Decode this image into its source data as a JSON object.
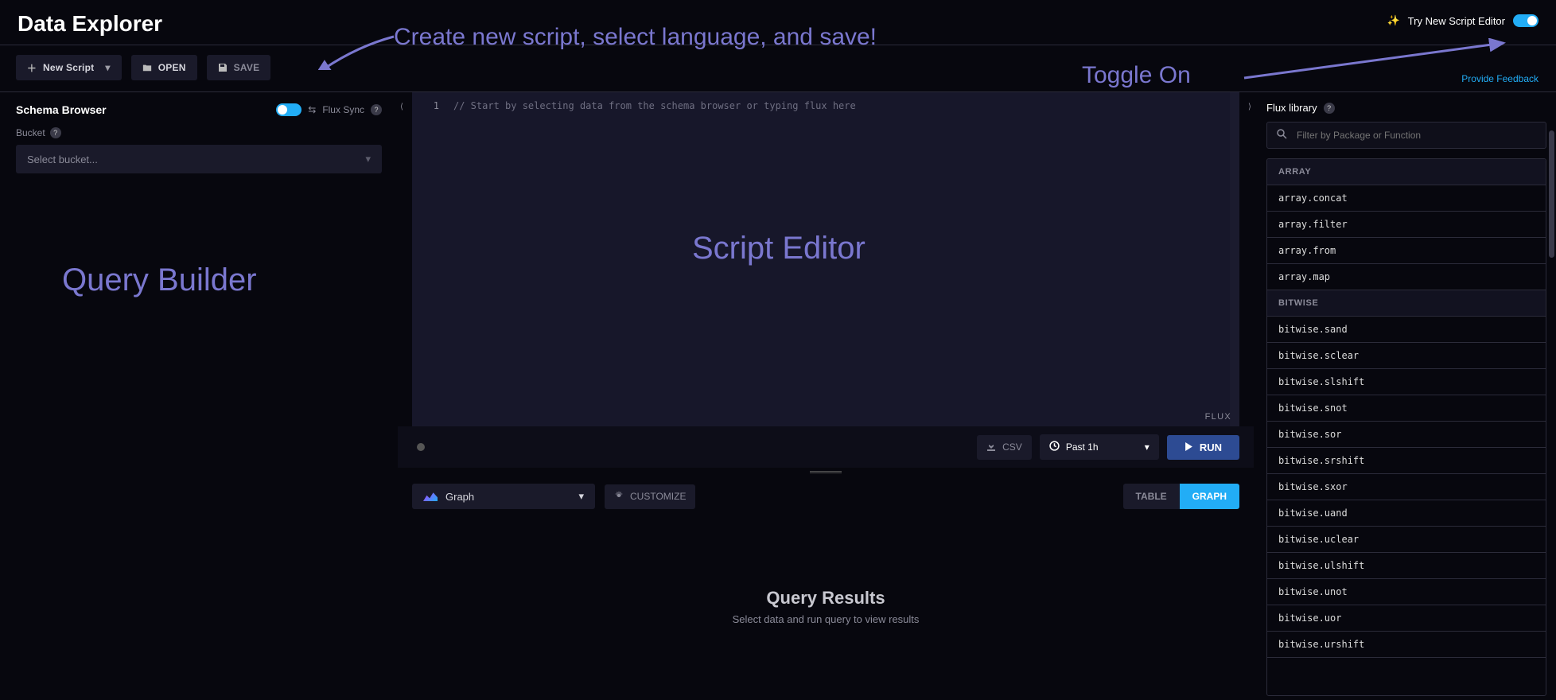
{
  "page_title": "Data Explorer",
  "top_right": {
    "sparkle": "✨",
    "try_label": "Try New Script Editor"
  },
  "feedback_link": "Provide Feedback",
  "toolbar": {
    "new_script": "New Script",
    "open": "OPEN",
    "save": "SAVE"
  },
  "schema": {
    "title": "Schema Browser",
    "flux_sync": "Flux Sync",
    "bucket_label": "Bucket",
    "select_placeholder": "Select bucket..."
  },
  "editor": {
    "line_number": "1",
    "placeholder_comment": "// Start by selecting data from the schema browser or typing flux here",
    "language": "FLUX"
  },
  "runbar": {
    "csv": "CSV",
    "time_range": "Past 1h",
    "run": "RUN"
  },
  "results_bar": {
    "viz_type": "Graph",
    "customize": "CUSTOMIZE",
    "table": "TABLE",
    "graph": "GRAPH"
  },
  "results": {
    "title": "Query Results",
    "subtitle": "Select data and run query to view results"
  },
  "library": {
    "title": "Flux library",
    "filter_placeholder": "Filter by Package or Function",
    "groups": [
      {
        "name": "ARRAY",
        "items": [
          "array.concat",
          "array.filter",
          "array.from",
          "array.map"
        ]
      },
      {
        "name": "BITWISE",
        "items": [
          "bitwise.sand",
          "bitwise.sclear",
          "bitwise.slshift",
          "bitwise.snot",
          "bitwise.sor",
          "bitwise.srshift",
          "bitwise.sxor",
          "bitwise.uand",
          "bitwise.uclear",
          "bitwise.ulshift",
          "bitwise.unot",
          "bitwise.uor",
          "bitwise.urshift"
        ]
      }
    ]
  },
  "annotations": {
    "create": "Create new script, select language, and save!",
    "toggle_on": "Toggle On",
    "script_editor": "Script Editor",
    "query_builder": "Query Builder"
  }
}
